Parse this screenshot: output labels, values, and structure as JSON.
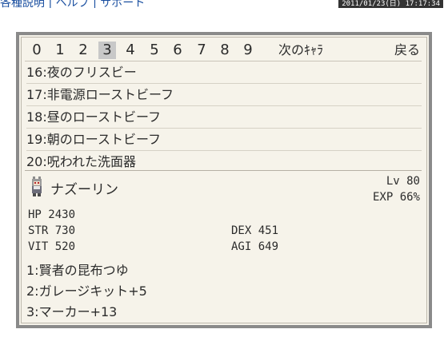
{
  "header": {
    "links_text": "各種説明 | ヘルプ | サポート",
    "timestamp": "2011/01/23(日) 17:17:34"
  },
  "tabs": [
    "0",
    "1",
    "2",
    "3",
    "4",
    "5",
    "6",
    "7",
    "8",
    "9"
  ],
  "active_tab": "3",
  "next_char_label": "次のｷｬﾗ",
  "back_label": "戻る",
  "items": [
    "16:夜のフリスビー",
    "17:非電源ローストビーフ",
    "18:昼のローストビーフ",
    "19:朝のローストビーフ",
    "20:呪われた洗面器"
  ],
  "character": {
    "name": "ナズーリン",
    "lv_text": "Lv 80",
    "exp_text": "EXP 66%",
    "hp_text": "HP  2430",
    "str_text": "STR 730",
    "dex_text": "DEX 451",
    "vit_text": "VIT 520",
    "agi_text": "AGI 649",
    "equipment": [
      "1:賢者の昆布つゆ",
      "2:ガレージキット+5",
      "3:マーカー+13"
    ]
  },
  "colors": {
    "panel_bg": "#f6f3ea",
    "frame": "#8a8a8a",
    "active_tab_bg": "#c8c8c8"
  }
}
